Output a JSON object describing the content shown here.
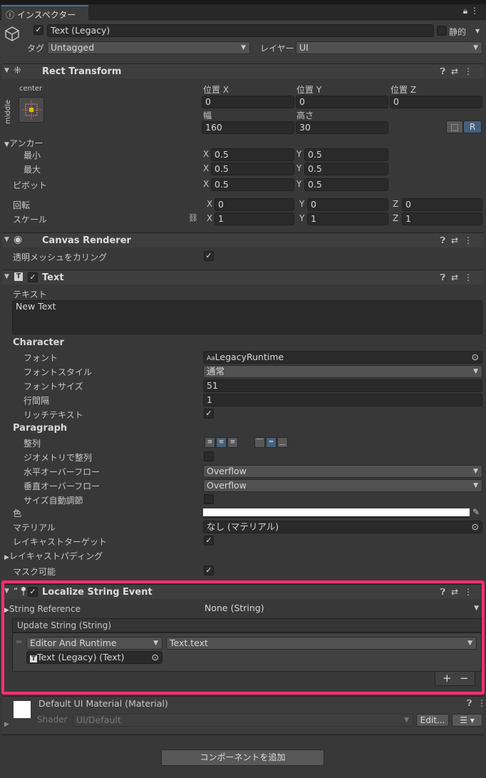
{
  "tab": {
    "title": "インスペクター"
  },
  "object": {
    "name": "Text (Legacy)",
    "static_label": "静的",
    "tag_label": "タグ",
    "tag_value": "Untagged",
    "layer_label": "レイヤー",
    "layer_value": "UI"
  },
  "rect_transform": {
    "title": "Rect Transform",
    "anchor_h": "center",
    "anchor_v": "middle",
    "pos_x_label": "位置 X",
    "pos_y_label": "位置 Y",
    "pos_z_label": "位置 Z",
    "pos_x": "0",
    "pos_y": "0",
    "pos_z": "0",
    "width_label": "幅",
    "height_label": "高さ",
    "width": "160",
    "height": "30",
    "r_button": "R",
    "anchors_label": "アンカー",
    "min_label": "最小",
    "max_label": "最大",
    "min_x": "0.5",
    "min_y": "0.5",
    "max_x": "0.5",
    "max_y": "0.5",
    "pivot_label": "ピボット",
    "pivot_x": "0.5",
    "pivot_y": "0.5",
    "rotation_label": "回転",
    "rot_x": "0",
    "rot_y": "0",
    "rot_z": "0",
    "scale_label": "スケール",
    "scale_x": "1",
    "scale_y": "1",
    "scale_z": "1",
    "x": "X",
    "y": "Y",
    "z": "Z"
  },
  "canvas_renderer": {
    "title": "Canvas Renderer",
    "cull_label": "透明メッシュをカリング"
  },
  "text": {
    "title": "Text",
    "text_label": "テキスト",
    "text_value": "New Text",
    "character": "Character",
    "font_label": "フォント",
    "font_value": "LegacyRuntime",
    "font_style_label": "フォントスタイル",
    "font_style_value": "通常",
    "font_size_label": "フォントサイズ",
    "font_size_value": "51",
    "line_spacing_label": "行間隔",
    "line_spacing_value": "1",
    "rich_text_label": "リッチテキスト",
    "paragraph": "Paragraph",
    "alignment_label": "整列",
    "geometry_label": "ジオメトリで整列",
    "h_overflow_label": "水平オーバーフロー",
    "h_overflow_value": "Overflow",
    "v_overflow_label": "垂直オーバーフロー",
    "v_overflow_value": "Overflow",
    "best_fit_label": "サイズ自動調節",
    "color_label": "色",
    "material_label": "マテリアル",
    "material_value": "なし (マテリアル)",
    "raycast_target_label": "レイキャストターゲット",
    "raycast_padding_label": "レイキャストパディング",
    "maskable_label": "マスク可能"
  },
  "localize": {
    "title": "Localize String Event",
    "string_ref_label": "String Reference",
    "string_ref_value": "None (String)",
    "event_title": "Update String (String)",
    "runtime_value": "Editor And Runtime",
    "method_value": "Text.text",
    "target_value": "Text (Legacy) (Text)",
    "plus": "+",
    "minus": "−"
  },
  "material": {
    "title": "Default UI Material (Material)",
    "shader_label": "Shader",
    "shader_value": "UI/Default",
    "edit_button": "Edit..."
  },
  "add_component": "コンポーネントを追加",
  "colors": {
    "highlight": "#ff2d73",
    "accent": "#3a72b0"
  }
}
